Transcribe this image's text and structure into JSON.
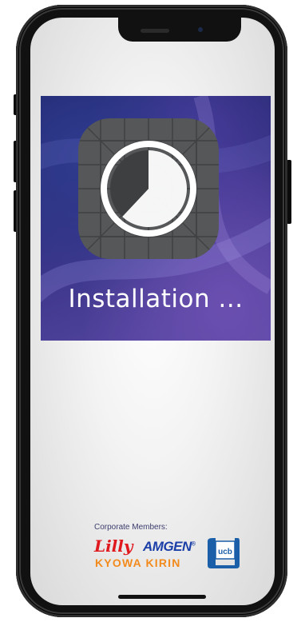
{
  "splash": {
    "status_text": "Installation ..."
  },
  "footer": {
    "corporate_label": "Corporate Members:",
    "logos": {
      "lilly": "Lilly",
      "amgen": "AMGEN",
      "kyowa_kirin": "KYOWA KIRIN",
      "ucb": "ucb"
    }
  },
  "icons": {
    "app_icon": "app-installing-icon",
    "progress_icon": "progress-pie-icon"
  },
  "colors": {
    "splash_gradient_start": "#1c2569",
    "splash_gradient_end": "#5a4aa6",
    "icon_background": "#555759",
    "lilly_red": "#e0191f",
    "amgen_blue": "#1b3fa8",
    "kyowa_orange": "#f28a1c",
    "ucb_blue": "#1b5fa8"
  },
  "install_progress": 0.62
}
